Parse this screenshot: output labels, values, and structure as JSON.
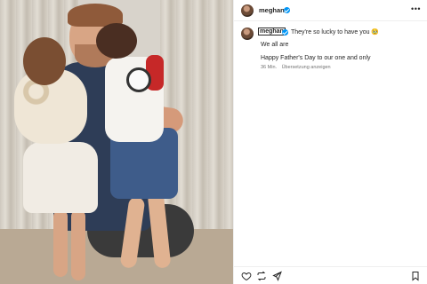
{
  "post": {
    "username": "meghan",
    "caption": {
      "username": "meghan",
      "text": "They're so lucky to have you 🥹",
      "line2": "We all are",
      "line3": "Happy Father's Day to our one and only"
    },
    "time": "36 Min.",
    "translate_label": "Übersetzung anzeigen"
  },
  "colors": {
    "verified": "#0095f6",
    "text": "#262626",
    "muted": "#737373"
  },
  "icons": {
    "more": "more-horizontal-icon",
    "like": "heart-icon",
    "share": "repost-icon",
    "send": "send-icon",
    "save": "bookmark-icon"
  },
  "more_glyph": "•••"
}
